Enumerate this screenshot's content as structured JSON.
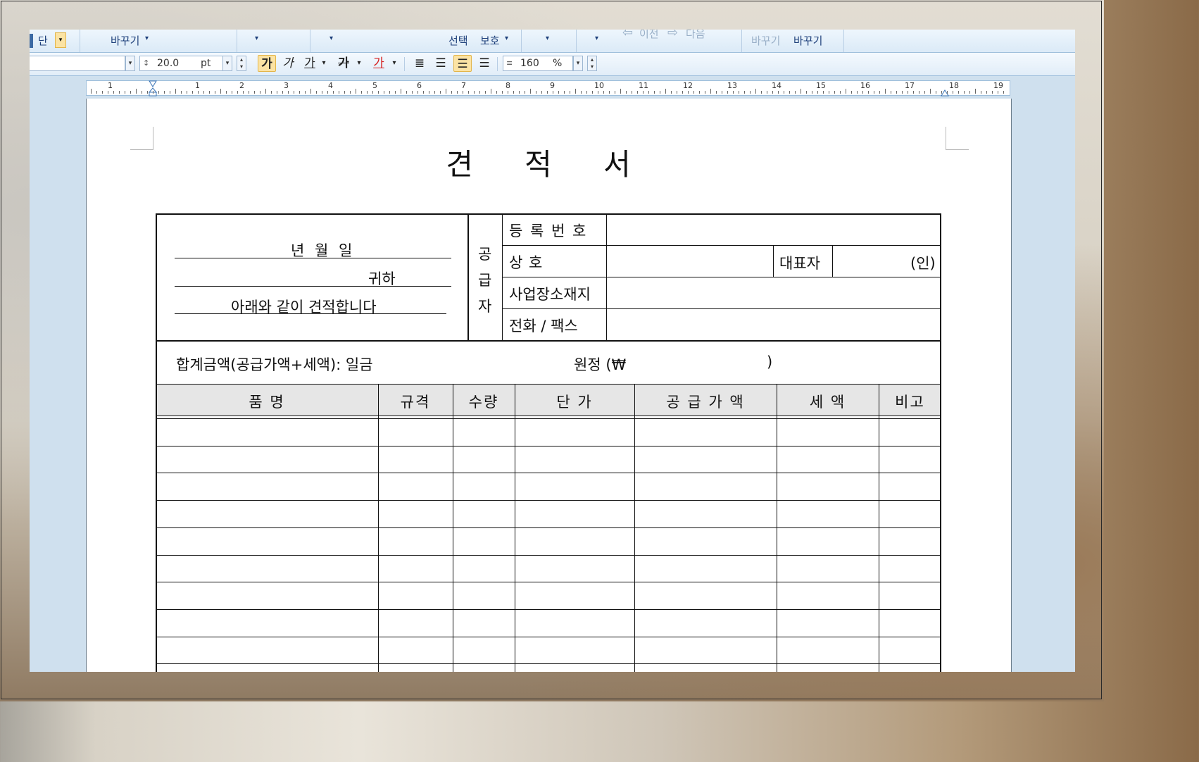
{
  "ribbon": {
    "col_label": "단",
    "replace_label": "바꾸기",
    "select_obj": "선택",
    "protect_obj": "보호",
    "prev_label": "이전",
    "next_label": "다음",
    "replace_a": "바꾸기",
    "replace_b": "바꾸기"
  },
  "toolbar": {
    "font_size": "20.0",
    "font_unit": "pt",
    "line_spacing": "160",
    "line_unit": "%",
    "bold_label": "가",
    "italic_label": "가",
    "underline_label": "가",
    "strike_label": "가",
    "color_label": "가"
  },
  "ruler": {
    "numbers": [
      "1",
      "1",
      "2",
      "3",
      "4",
      "5",
      "6",
      "7",
      "8",
      "9",
      "10",
      "11",
      "12",
      "13",
      "14",
      "15",
      "16",
      "17",
      "18",
      "19"
    ]
  },
  "document": {
    "title": "견 적 서",
    "date_line": "년     월     일",
    "to_line": "귀하",
    "intro_line": "아래와 같이 견적합니다",
    "supplier_label": [
      "공",
      "급",
      "자"
    ],
    "reg_no_label": "등 록 번 호",
    "company_label": "상          호",
    "ceo_label": "대표자",
    "seal_label": "(인)",
    "address_label": "사업장소재지",
    "phone_label": "전화 / 팩스",
    "total_label": "합계금액(공급가액+세액): 일금",
    "total_won": "원정 (₩",
    "total_close": ")",
    "columns": [
      "품          명",
      "규격",
      "수량",
      "단  가",
      "공 급 가 액",
      "세      액",
      "비고"
    ]
  },
  "colors": {
    "app_bg": "#cfe0ee",
    "ribbon_text": "#1d3f7a",
    "highlight": "#fbe3a4"
  }
}
